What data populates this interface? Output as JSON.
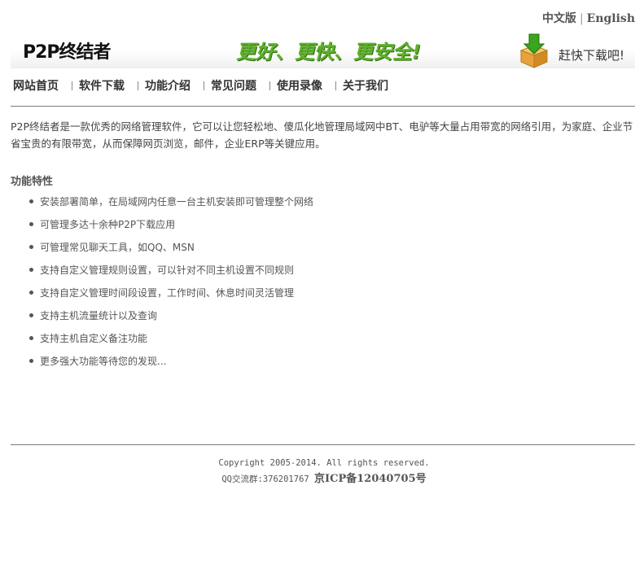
{
  "lang": {
    "zh": "中文版",
    "sep": "|",
    "en": "English"
  },
  "header": {
    "logo": "P2P终结者",
    "slogan": "更好、更快、更安全!",
    "download": "赶快下载吧!"
  },
  "nav": {
    "items": [
      {
        "label": "网站首页"
      },
      {
        "label": "软件下载"
      },
      {
        "label": "功能介绍"
      },
      {
        "label": "常见问题"
      },
      {
        "label": "使用录像"
      },
      {
        "label": "关于我们"
      }
    ]
  },
  "intro": "P2P终结者是一款优秀的网络管理软件，它可以让您轻松地、傻瓜化地管理局域网中BT、电驴等大量占用带宽的网络引用，为家庭、企业节省宝贵的有限带宽，从而保障网页浏览，邮件，企业ERP等关键应用。",
  "features": {
    "title": "功能特性",
    "items": [
      "安装部署简单，在局域网内任意一台主机安装即可管理整个网络",
      "可管理多达十余种P2P下载应用",
      "可管理常见聊天工具，如QQ、MSN",
      "支持自定义管理规则设置，可以针对不同主机设置不同规则",
      "支持自定义管理时间段设置，工作时间、休息时间灵活管理",
      "支持主机流量统计以及查询",
      "支持主机自定义备注功能",
      "更多强大功能等待您的发现..."
    ]
  },
  "footer": {
    "copyright": "Copyright 2005-2014. All rights reserved.",
    "qq": "QQ交流群:376201767",
    "icp": "京ICP备12040705号"
  },
  "colors": {
    "slogan": "#5fb02a",
    "download_arrow": "#3aa51e",
    "box": "#e8a23a"
  }
}
